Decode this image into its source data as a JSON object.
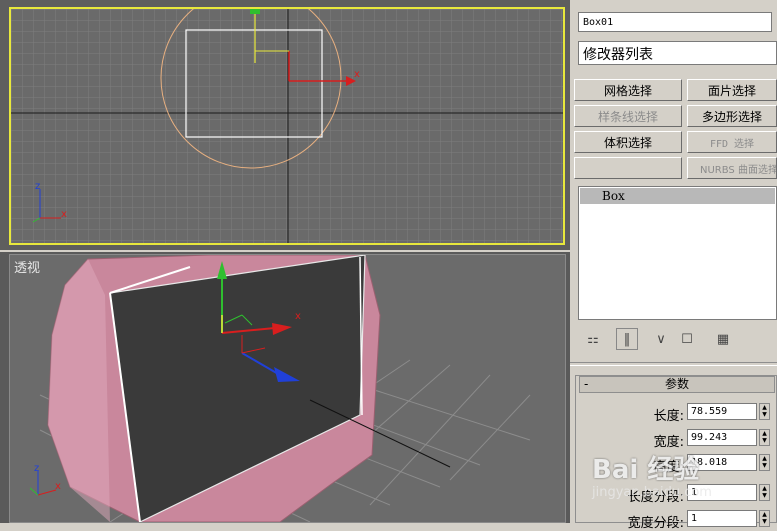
{
  "viewports": {
    "top": {
      "axis_x": "x",
      "axis_y": "y",
      "corner_x": "x",
      "corner_y": "z"
    },
    "perspective": {
      "label": "透视",
      "axis_x": "x",
      "corner_x": "x",
      "corner_y": "z"
    }
  },
  "panel": {
    "object_name": "Box01",
    "modifier_list": "修改器列表",
    "buttons": [
      {
        "label": "网格选择",
        "enabled": true
      },
      {
        "label": "面片选择",
        "enabled": true
      },
      {
        "label": "样条线选择",
        "enabled": false
      },
      {
        "label": "多边形选择",
        "enabled": true
      },
      {
        "label": "体积选择",
        "enabled": true
      },
      {
        "label": "FFD 选择",
        "enabled": false
      },
      {
        "label": "",
        "enabled": false
      },
      {
        "label": "NURBS 曲面选择",
        "enabled": false
      }
    ],
    "stack_item": "Box",
    "params": {
      "title": "参数",
      "collapse": "-",
      "length_label": "长度:",
      "length_value": "78.559",
      "width_label": "宽度:",
      "width_value": "99.243",
      "height_label": "高度:",
      "height_value": "18.018",
      "length_segs_label": "长度分段:",
      "length_segs_value": "1",
      "width_segs_label": "宽度分段:",
      "width_segs_value": "1"
    }
  },
  "watermark": {
    "logo": "Bai 经验",
    "url": "jingyan.baidu.com"
  },
  "colors": {
    "viewport_border_active": "#e8e83c",
    "axis_x": "#d81e1e",
    "axis_y": "#2fbf2f",
    "axis_z": "#2040d8",
    "box_pink": "#c9879c"
  }
}
